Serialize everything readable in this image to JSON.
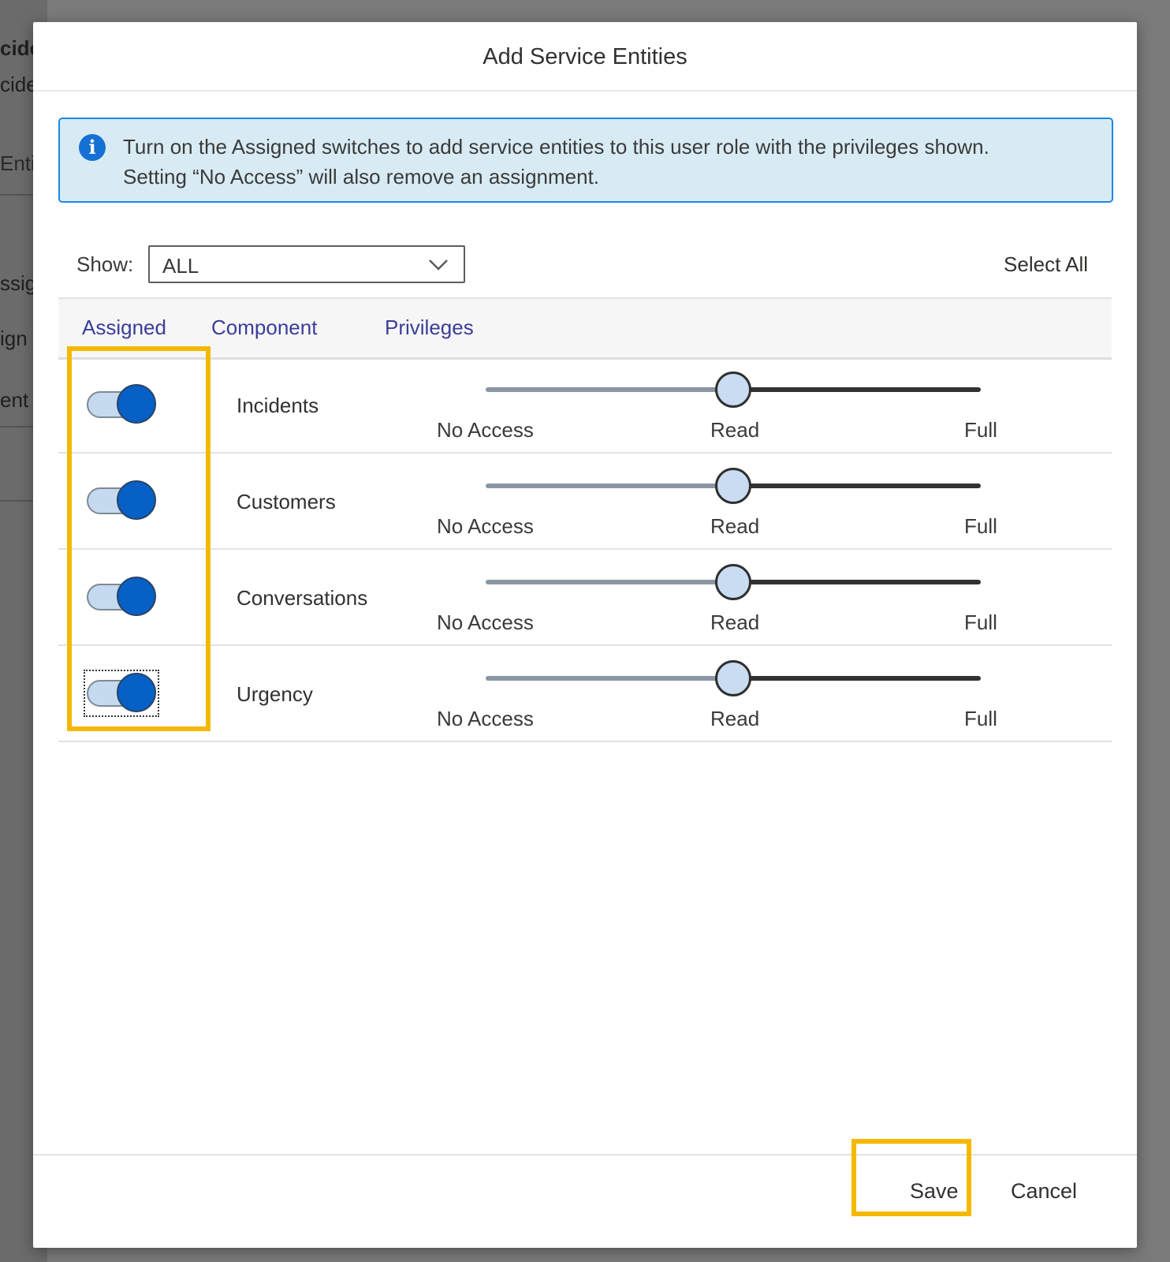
{
  "background": {
    "fragments": [
      "cide",
      "cide",
      "Entit",
      "ssig",
      "ign",
      "ent"
    ]
  },
  "dialog": {
    "title": "Add Service Entities",
    "info": {
      "icon": "info-icon",
      "line1": "Turn on the Assigned switches to add service entities to this user role with the privileges shown.",
      "line2": "Setting “No Access” will also remove an assignment."
    },
    "filter": {
      "label": "Show:",
      "value": "ALL",
      "icon": "chevron-down-icon"
    },
    "select_all": "Select All",
    "columns": [
      "Assigned",
      "Component",
      "Privileges"
    ],
    "privilege_levels": [
      "No Access",
      "Read",
      "Full"
    ],
    "rows": [
      {
        "component": "Incidents",
        "assigned": true,
        "privilege": "Read"
      },
      {
        "component": "Customers",
        "assigned": true,
        "privilege": "Read"
      },
      {
        "component": "Conversations",
        "assigned": true,
        "privilege": "Read"
      },
      {
        "component": "Urgency",
        "assigned": true,
        "privilege": "Read"
      }
    ],
    "buttons": {
      "save": "Save",
      "cancel": "Cancel"
    },
    "colors": {
      "accent": "#0660c6",
      "highlight": "#f5b800",
      "info_bg": "#d8ebf4",
      "header_link": "#3b3d99"
    }
  }
}
